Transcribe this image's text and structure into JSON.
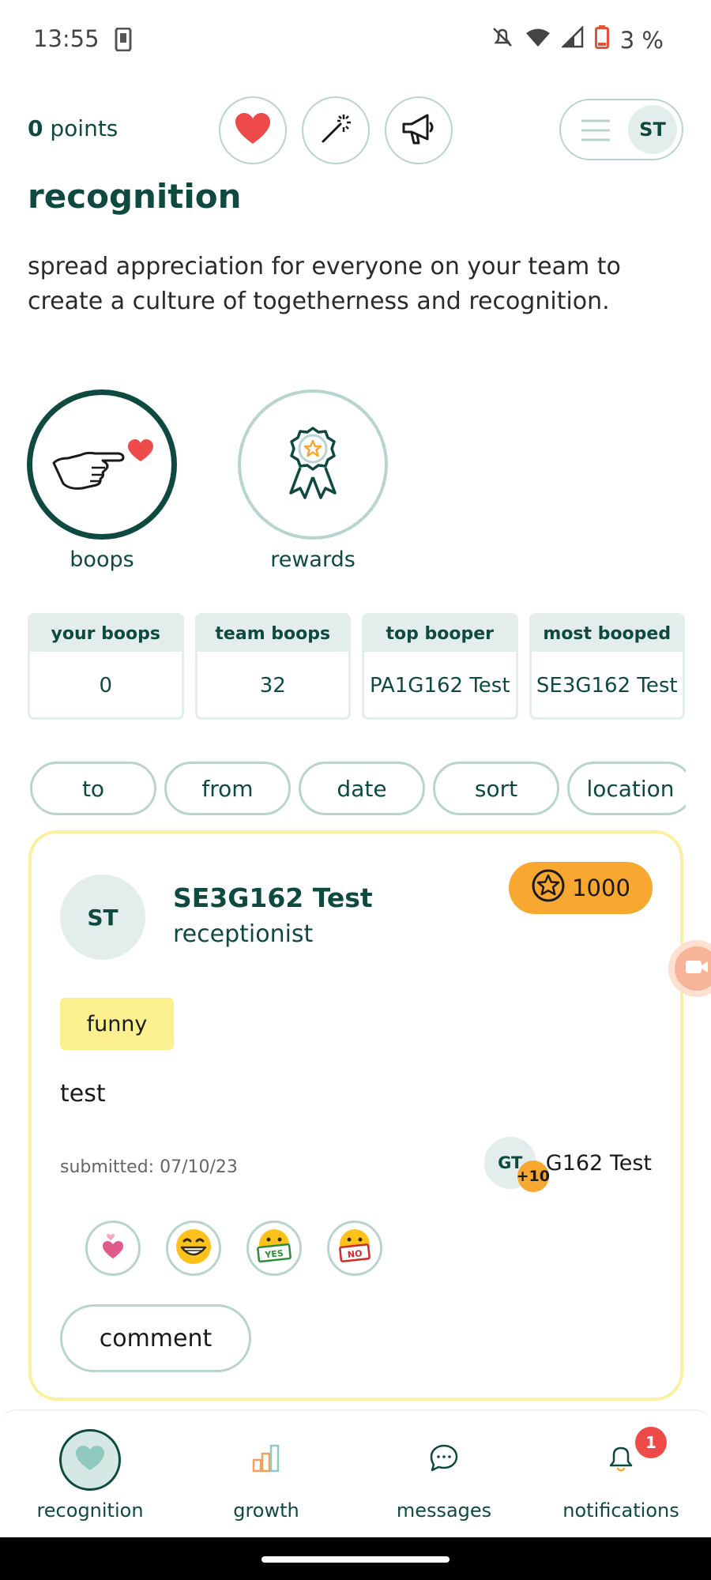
{
  "status_bar": {
    "time": "13:55",
    "battery": "3 %"
  },
  "header": {
    "points_value": "0",
    "points_label": " points",
    "avatar_initials": "ST"
  },
  "page": {
    "title": "recognition",
    "description": "spread appreciation for everyone on your team to create a culture of togetherness and recognition."
  },
  "categories": [
    {
      "label": "boops",
      "icon": "pointing-hand-heart-icon",
      "selected": true
    },
    {
      "label": "rewards",
      "icon": "award-ribbon-icon",
      "selected": false
    }
  ],
  "stats": [
    {
      "header": "your boops",
      "value": "0"
    },
    {
      "header": "team boops",
      "value": "32"
    },
    {
      "header": "top booper",
      "value": "PA1G162 Test"
    },
    {
      "header": "most booped",
      "value": "SE3G162 Test"
    }
  ],
  "filters": [
    "to",
    "from",
    "date",
    "sort",
    "location"
  ],
  "card": {
    "avatar_initials": "ST",
    "name": "SE3G162 Test",
    "role": "receptionist",
    "points": "1000",
    "tag": "funny",
    "message": "test",
    "submitted": "submitted: 07/10/23",
    "giver_initials": "GT",
    "giver_bonus": "+10",
    "giver_name": "G162 Test",
    "reactions": [
      "heart-icon",
      "grin-emoji-icon",
      "yes-sign-emoji-icon",
      "no-sign-emoji-icon"
    ],
    "comment_label": "comment"
  },
  "bottom_nav": [
    {
      "label": "recognition",
      "icon": "heart-icon",
      "active": true
    },
    {
      "label": "growth",
      "icon": "bar-chart-icon",
      "active": false
    },
    {
      "label": "messages",
      "icon": "chat-bubble-icon",
      "active": false
    },
    {
      "label": "notifications",
      "icon": "bell-icon",
      "active": false,
      "badge": "1"
    }
  ],
  "colors": {
    "brand": "#0e4a40",
    "accent_light": "#e3eeec",
    "border": "#b8d4cf",
    "heart": "#ef4a4a",
    "badge_orange": "#f8a731",
    "tag_yellow": "#faf08f",
    "card_border": "#fbf0a0"
  }
}
